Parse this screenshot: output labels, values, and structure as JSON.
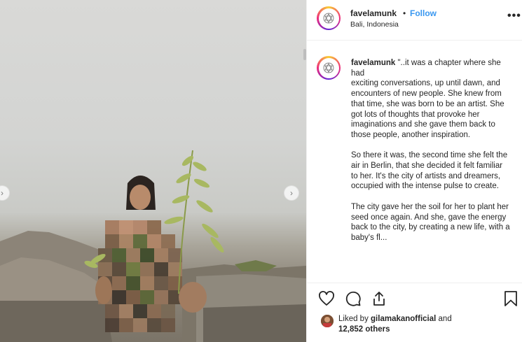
{
  "post": {
    "username": "favelamunk",
    "follow_label": "Follow",
    "dot": "•",
    "location": "Bali, Indonesia",
    "more_label": "•••"
  },
  "caption": {
    "username": "favelamunk",
    "text": " \"..it was a chapter where she had\nexciting conversations, up until dawn, and encounters of new people. She knew from that time, she was born to be an artist. She got lots of thoughts that provoke her imaginations and she gave them back to those people, another inspiration.\n\nSo there it was, the second time she felt the air in Berlin, that she decided it felt familiar to her. It's the city of artists and dreamers, occupied with the intense pulse to create.\n\nThe city gave her the soil for her to plant her seed once again. And she, gave the energy back to the city, by creating a new life, with a baby's fl..."
  },
  "likes": {
    "prefix": "Liked by ",
    "liker": "gilamakanofficial",
    "middle": " and",
    "count": "12,852 others"
  },
  "icons": {
    "like": "heart-icon",
    "comment": "comment-icon",
    "share": "share-icon",
    "save": "bookmark-icon",
    "prev": "chevron-left-icon",
    "next": "chevron-right-icon"
  },
  "colors": {
    "accent": "#3897f0",
    "text": "#262626",
    "border": "#efefef"
  }
}
